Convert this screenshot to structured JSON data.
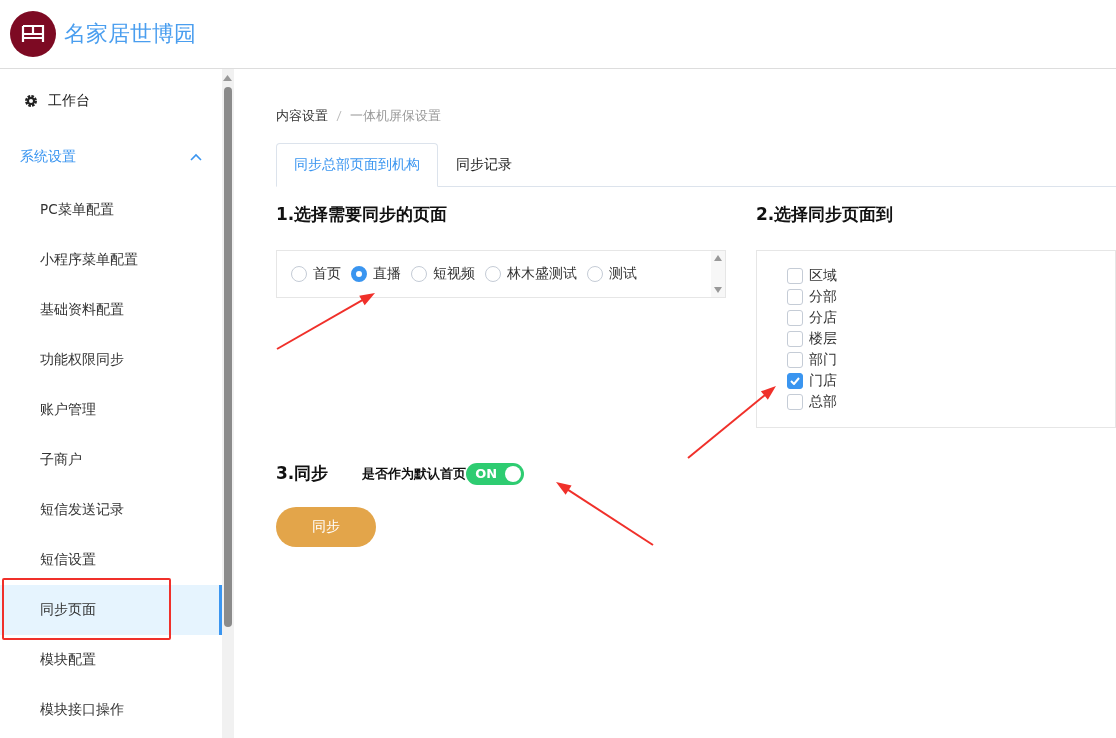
{
  "header": {
    "title": "名家居世博园"
  },
  "sidebar": {
    "items": [
      {
        "label": "工作台",
        "kind": "top",
        "selected": false
      }
    ],
    "group": {
      "label": "系统设置",
      "expanded": true,
      "children": [
        {
          "label": "PC菜单配置",
          "selected": false
        },
        {
          "label": "小程序菜单配置",
          "selected": false
        },
        {
          "label": "基础资料配置",
          "selected": false
        },
        {
          "label": "功能权限同步",
          "selected": false
        },
        {
          "label": "账户管理",
          "selected": false
        },
        {
          "label": "子商户",
          "selected": false
        },
        {
          "label": "短信发送记录",
          "selected": false
        },
        {
          "label": "短信设置",
          "selected": false
        },
        {
          "label": "同步页面",
          "selected": true
        },
        {
          "label": "模块配置",
          "selected": false
        },
        {
          "label": "模块接口操作",
          "selected": false
        }
      ]
    }
  },
  "breadcrumb": [
    "内容设置",
    "一体机屏保设置"
  ],
  "tabs": [
    {
      "label": "同步总部页面到机构",
      "selected": true
    },
    {
      "label": "同步记录",
      "selected": false
    }
  ],
  "section1": {
    "title": "1.选择需要同步的页面",
    "options": [
      {
        "label": "首页",
        "selected": false
      },
      {
        "label": "直播",
        "selected": true
      },
      {
        "label": "短视频",
        "selected": false
      },
      {
        "label": "林木盛测试",
        "selected": false
      },
      {
        "label": "测试",
        "selected": false
      }
    ]
  },
  "section2": {
    "title": "2.选择同步页面到",
    "options": [
      {
        "label": "区域",
        "checked": false
      },
      {
        "label": "分部",
        "checked": false
      },
      {
        "label": "分店",
        "checked": false
      },
      {
        "label": "楼层",
        "checked": false
      },
      {
        "label": "部门",
        "checked": false
      },
      {
        "label": "门店",
        "checked": true
      },
      {
        "label": "总部",
        "checked": false
      }
    ]
  },
  "section3": {
    "title": "3.同步",
    "toggle_label": "是否作为默认首页",
    "toggle": {
      "on": true,
      "text": "ON"
    },
    "button": "同步"
  }
}
